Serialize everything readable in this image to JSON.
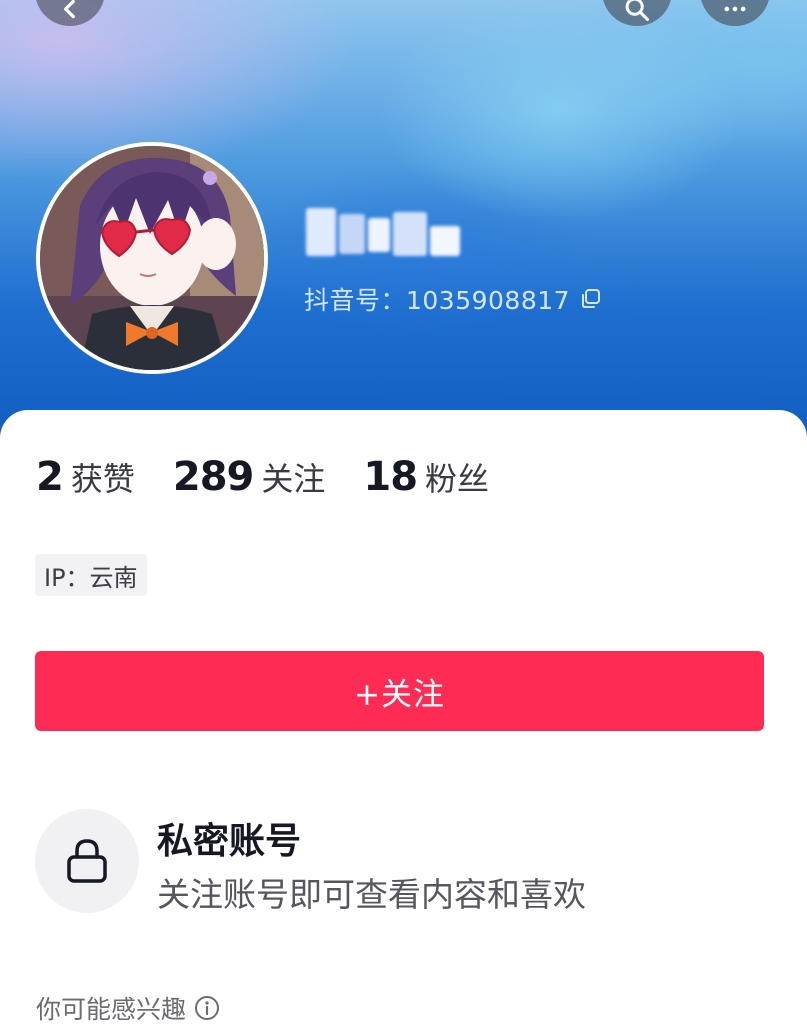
{
  "header": {
    "back_icon": "chevron-left-icon",
    "search_icon": "search-icon",
    "more_icon": "more-icon",
    "username_blurred": true,
    "douyin_id_label": "抖音号：1035908817",
    "copy_icon": "copy-icon"
  },
  "stats": [
    {
      "value": "2",
      "label": "获赞"
    },
    {
      "value": "289",
      "label": "关注"
    },
    {
      "value": "18",
      "label": "粉丝"
    }
  ],
  "ip_label": "IP：云南",
  "follow_button": {
    "label": "+关注",
    "color": "#fe2c55"
  },
  "private_account": {
    "icon": "lock-icon",
    "title": "私密账号",
    "description": "关注账号即可查看内容和喜欢"
  },
  "suggestions": {
    "label": "你可能感兴趣",
    "icon": "info-icon"
  }
}
